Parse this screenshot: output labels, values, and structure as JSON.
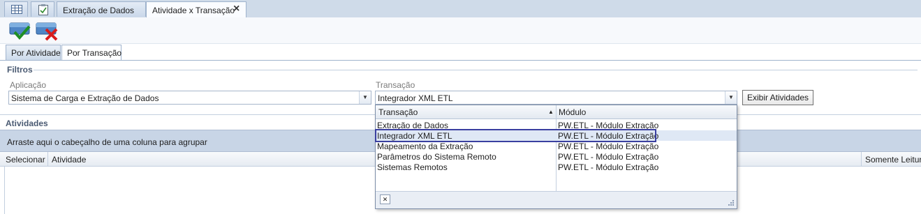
{
  "document_tabs": [
    {
      "label": ""
    },
    {
      "label": ""
    },
    {
      "label": "Extração de Dados"
    },
    {
      "label": "Atividade x Transação",
      "close": "×"
    }
  ],
  "view_tabs": [
    "Por Atividade",
    "Por Transação"
  ],
  "filters": {
    "title": "Filtros",
    "aplicacao_label": "Aplicação",
    "aplicacao_value": "Sistema de Carga e Extração de Dados",
    "transacao_label": "Transação",
    "transacao_value": "Integrador XML ETL",
    "exibir_button": "Exibir Atividades"
  },
  "atividades": {
    "title": "Atividades",
    "group_hint": "Arraste aqui o cabeçalho de uma coluna para agrupar",
    "columns": [
      "Selecionar",
      "Atividade",
      "Somente Leitura"
    ]
  },
  "dropdown": {
    "columns": [
      "Transação",
      "Módulo"
    ],
    "rows": [
      {
        "transacao": "Extração de Dados",
        "modulo": "PW.ETL - Módulo Extração"
      },
      {
        "transacao": "Integrador XML ETL",
        "modulo": "PW.ETL - Módulo Extração"
      },
      {
        "transacao": "Mapeamento da Extração",
        "modulo": "PW.ETL - Módulo Extração"
      },
      {
        "transacao": "Parâmetros do Sistema Remoto",
        "modulo": "PW.ETL - Módulo Extração"
      },
      {
        "transacao": "Sistemas Remotos",
        "modulo": "PW.ETL - Módulo Extração"
      }
    ],
    "selected_index": 1,
    "clear_glyph": "✕"
  },
  "icons": {
    "grid_tab": "grid-icon",
    "checklist_tab": "checklist-icon",
    "confirm": "save-confirm-icon",
    "cancel": "cancel-icon"
  }
}
